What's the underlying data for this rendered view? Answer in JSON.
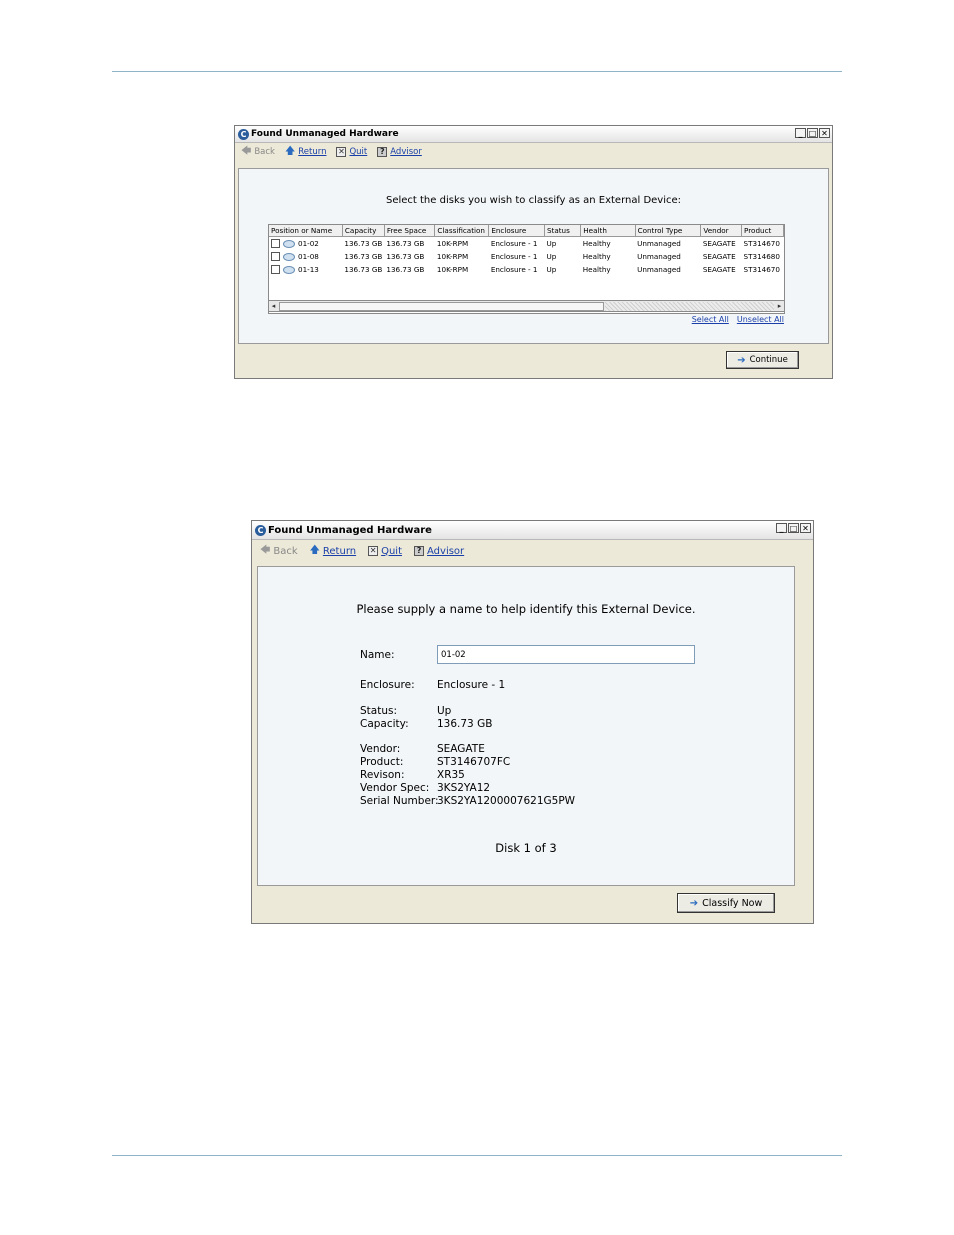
{
  "window1": {
    "title": "Found Unmanaged Hardware",
    "nav": {
      "back": "Back",
      "return": "Return",
      "quit": "Quit",
      "advisor": "Advisor"
    },
    "prompt": "Select the disks you wish to classify as an External Device:",
    "columns": [
      "Position or Name",
      "Capacity",
      "Free Space",
      "Classification",
      "Enclosure",
      "Status",
      "Health",
      "Control Type",
      "Vendor",
      "Product"
    ],
    "rows": [
      [
        "01-02",
        "136.73 GB",
        "136.73 GB",
        "10K-RPM",
        "Enclosure - 1",
        "Up",
        "Healthy",
        "Unmanaged",
        "SEAGATE",
        "ST314670"
      ],
      [
        "01-08",
        "136.73 GB",
        "136.73 GB",
        "10K-RPM",
        "Enclosure - 1",
        "Up",
        "Healthy",
        "Unmanaged",
        "SEAGATE",
        "ST314680"
      ],
      [
        "01-13",
        "136.73 GB",
        "136.73 GB",
        "10K-RPM",
        "Enclosure - 1",
        "Up",
        "Healthy",
        "Unmanaged",
        "SEAGATE",
        "ST314670"
      ]
    ],
    "select_all": "Select All",
    "unselect_all": "Unselect All",
    "continue": "Continue"
  },
  "window2": {
    "title": "Found Unmanaged Hardware",
    "nav": {
      "back": "Back",
      "return": "Return",
      "quit": "Quit",
      "advisor": "Advisor"
    },
    "prompt": "Please supply a name to help identify this External Device.",
    "name_label": "Name:",
    "name_value": "01-02",
    "enclosure_label": "Enclosure:",
    "enclosure_value": "Enclosure - 1",
    "status_label": "Status:",
    "status_value": "Up",
    "capacity_label": "Capacity:",
    "capacity_value": "136.73 GB",
    "vendor_label": "Vendor:",
    "vendor_value": "SEAGATE",
    "product_label": "Product:",
    "product_value": "ST3146707FC",
    "revision_label": "Revison:",
    "revision_value": "XR35",
    "vendor_spec_label": "Vendor Spec:",
    "vendor_spec_value": "3KS2YA12",
    "serial_label": "Serial Number:",
    "serial_value": "3KS2YA1200007621G5PW",
    "disk_count": "Disk 1 of 3",
    "classify": "Classify Now"
  }
}
